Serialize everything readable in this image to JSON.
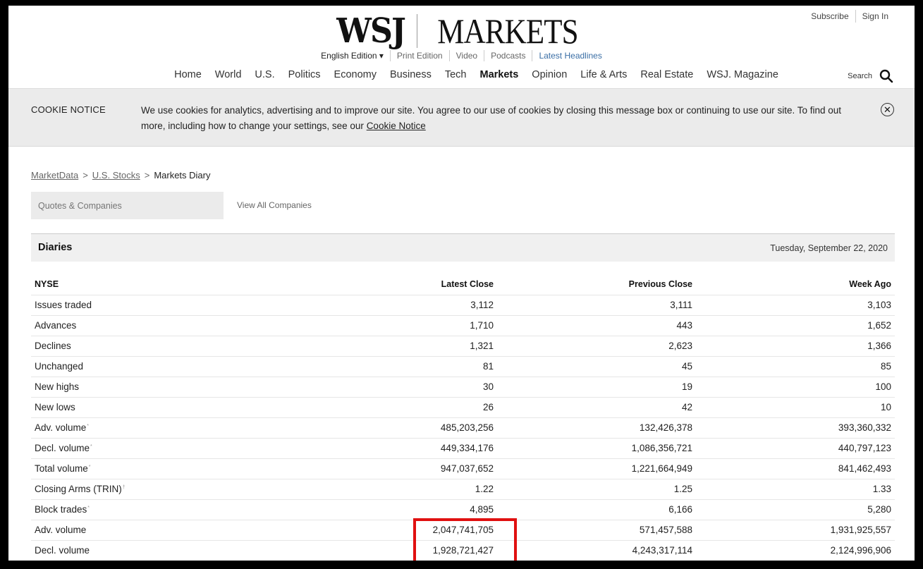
{
  "header": {
    "logo_left": "WSJ",
    "logo_right": "MARKETS",
    "account": [
      "Subscribe",
      "Sign In"
    ],
    "editions": [
      "English Edition ▾",
      "Print Edition",
      "Video",
      "Podcasts",
      "Latest Headlines"
    ],
    "nav": [
      "Home",
      "World",
      "U.S.",
      "Politics",
      "Economy",
      "Business",
      "Tech",
      "Markets",
      "Opinion",
      "Life & Arts",
      "Real Estate",
      "WSJ. Magazine"
    ],
    "active_nav": "Markets",
    "search_label": "Search"
  },
  "cookie": {
    "title": "COOKIE NOTICE",
    "text": "We use cookies for analytics, advertising and to improve our site. You agree to our use of cookies by closing this message box or continuing to use our site. To find out more, including how to change your settings, see our ",
    "link": "Cookie Notice",
    "close": "✕"
  },
  "breadcrumb": {
    "items": [
      "MarketData",
      "U.S. Stocks",
      "Markets Diary"
    ],
    "separator": ">"
  },
  "search": {
    "placeholder": "Quotes & Companies",
    "view_all": "View All Companies"
  },
  "diaries": {
    "title": "Diaries",
    "date": "Tuesday, September 22, 2020"
  },
  "table": {
    "headers": [
      "NYSE",
      "Latest Close",
      "Previous Close",
      "Week Ago"
    ],
    "rows": [
      {
        "label": "Issues traded",
        "sup": "",
        "values": [
          "3,112",
          "3,111",
          "3,103"
        ]
      },
      {
        "label": "Advances",
        "sup": "",
        "values": [
          "1,710",
          "443",
          "1,652"
        ]
      },
      {
        "label": "Declines",
        "sup": "",
        "values": [
          "1,321",
          "2,623",
          "1,366"
        ]
      },
      {
        "label": "Unchanged",
        "sup": "",
        "values": [
          "81",
          "45",
          "85"
        ]
      },
      {
        "label": "New highs",
        "sup": "",
        "values": [
          "30",
          "19",
          "100"
        ]
      },
      {
        "label": "New lows",
        "sup": "",
        "values": [
          "26",
          "42",
          "10"
        ]
      },
      {
        "label": "Adv. volume",
        "sup": "*",
        "values": [
          "485,203,256",
          "132,426,378",
          "393,360,332"
        ]
      },
      {
        "label": "Decl. volume",
        "sup": "*",
        "values": [
          "449,334,176",
          "1,086,356,721",
          "440,797,123"
        ]
      },
      {
        "label": "Total volume",
        "sup": "*",
        "values": [
          "947,037,652",
          "1,221,664,949",
          "841,462,493"
        ]
      },
      {
        "label": "Closing Arms (TRIN)",
        "sup": "†",
        "values": [
          "1.22",
          "1.25",
          "1.33"
        ]
      },
      {
        "label": "Block trades",
        "sup": "*",
        "values": [
          "4,895",
          "6,166",
          "5,280"
        ]
      },
      {
        "label": "Adv. volume",
        "sup": "",
        "values": [
          "2,047,741,705",
          "571,457,588",
          "1,931,925,557"
        ]
      },
      {
        "label": "Decl. volume",
        "sup": "",
        "values": [
          "1,928,721,427",
          "4,243,317,114",
          "2,124,996,906"
        ]
      }
    ]
  },
  "colors": {
    "highlight_box": "#e01010",
    "link_blue": "#3a6ea5",
    "cookie_bg": "#ebebeb"
  }
}
